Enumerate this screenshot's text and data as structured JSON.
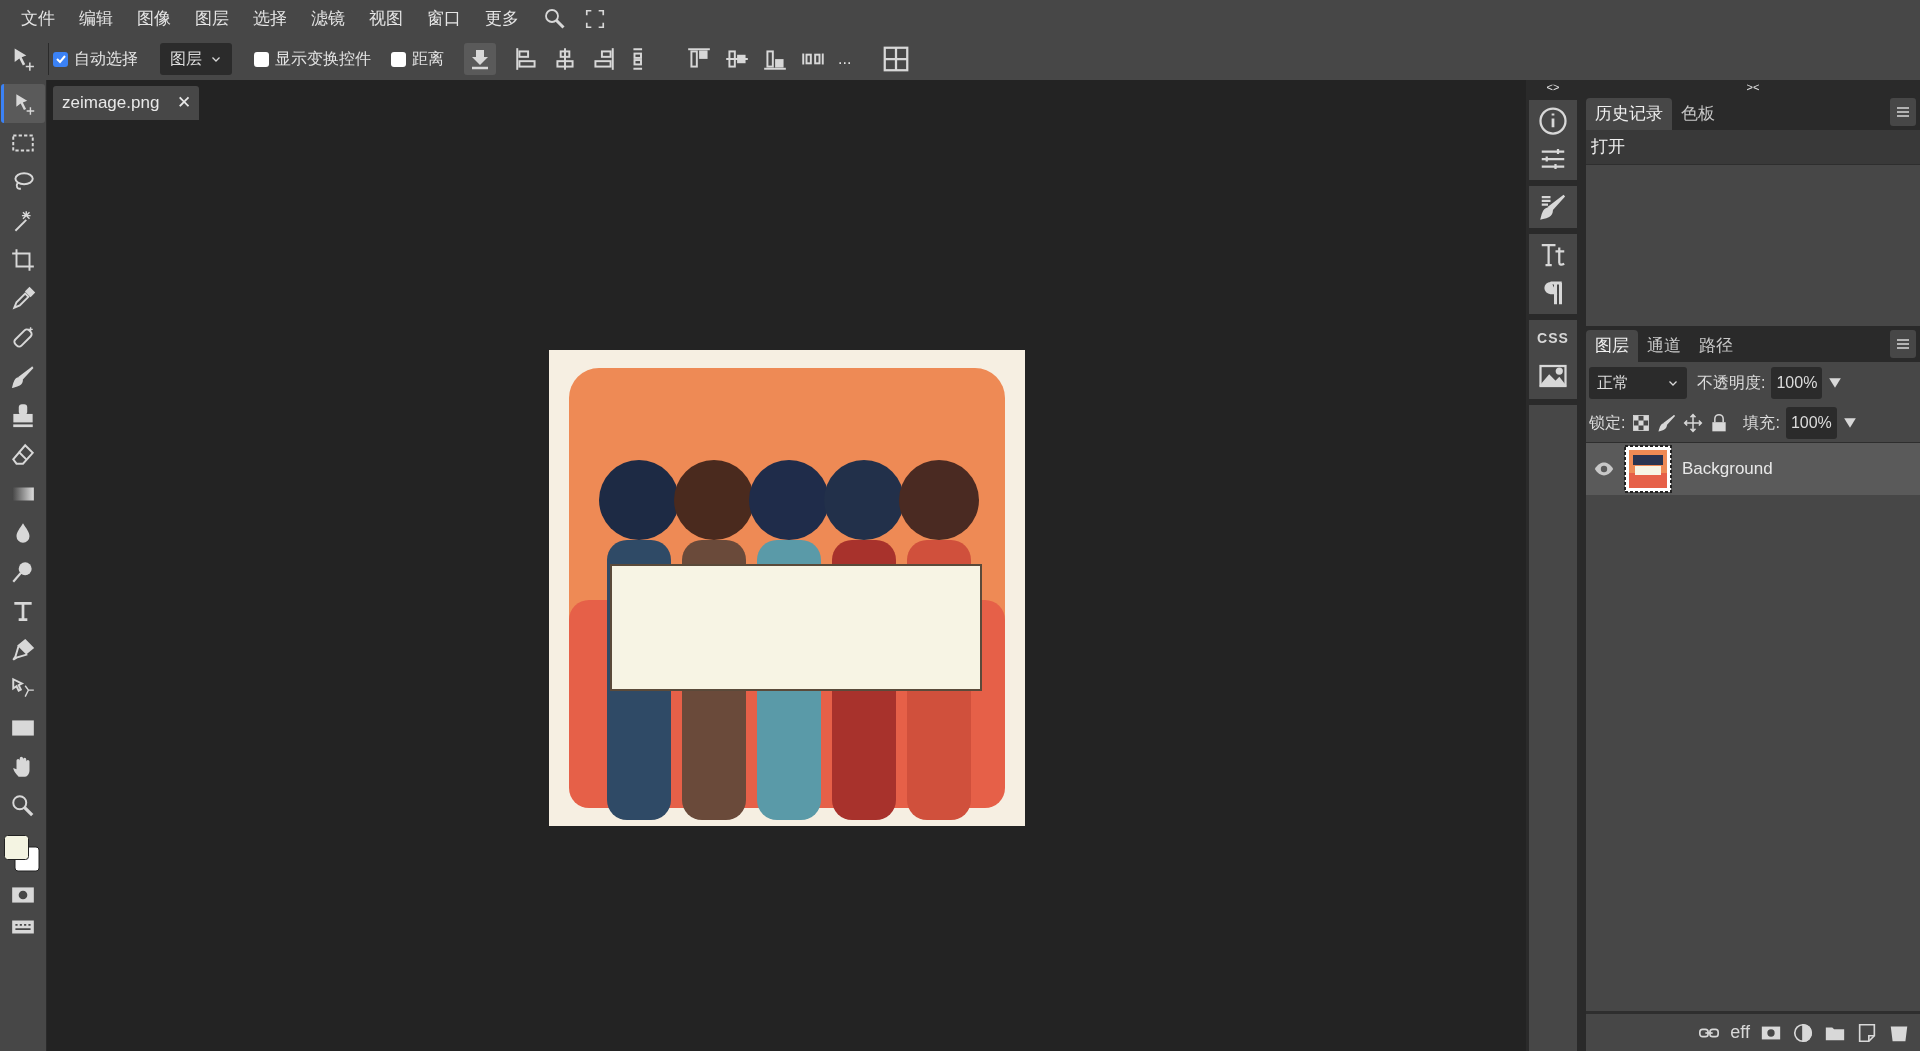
{
  "menu": [
    "文件",
    "编辑",
    "图像",
    "图层",
    "选择",
    "滤镜",
    "视图",
    "窗口",
    "更多"
  ],
  "options_bar": {
    "auto_select": {
      "label": "自动选择",
      "checked": true
    },
    "target": "图层",
    "show_transform": {
      "label": "显示变换控件",
      "checked": false
    },
    "distance": {
      "label": "距离",
      "checked": false
    },
    "more": "..."
  },
  "tools": [
    {
      "kind": "move",
      "selected": true
    },
    {
      "kind": "marquee",
      "selected": false
    },
    {
      "kind": "lasso",
      "selected": false
    },
    {
      "kind": "wand",
      "selected": false
    },
    {
      "kind": "crop",
      "selected": false
    },
    {
      "kind": "eyedropper",
      "selected": false
    },
    {
      "kind": "healing",
      "selected": false
    },
    {
      "kind": "brush",
      "selected": false
    },
    {
      "kind": "stamp",
      "selected": false
    },
    {
      "kind": "eraser",
      "selected": false
    },
    {
      "kind": "gradient",
      "selected": false
    },
    {
      "kind": "blur",
      "selected": false
    },
    {
      "kind": "dodge",
      "selected": false
    },
    {
      "kind": "type",
      "selected": false
    },
    {
      "kind": "pen",
      "selected": false
    },
    {
      "kind": "path",
      "selected": false
    },
    {
      "kind": "rect",
      "selected": false
    },
    {
      "kind": "hand",
      "selected": false
    },
    {
      "kind": "zoom",
      "selected": false
    }
  ],
  "color_swatches": [
    {
      "color": "#f4f4e2"
    },
    {
      "color": "#ffffff"
    }
  ],
  "document_tab": {
    "title": "zeimage.png",
    "close": "✕"
  },
  "side_strip": {
    "expand": "<>",
    "css": "CSS"
  },
  "collapse": "><",
  "history_panel": {
    "tabs": [
      {
        "label": "历史记录",
        "selected": true
      },
      {
        "label": "色板",
        "selected": false
      }
    ],
    "entries": [
      {
        "label": "打开",
        "selected": true
      }
    ]
  },
  "layers_panel": {
    "tabs": [
      {
        "label": "图层",
        "selected": true
      },
      {
        "label": "通道",
        "selected": false
      },
      {
        "label": "路径",
        "selected": false
      }
    ],
    "blend_mode": "正常",
    "opacity_label": "不透明度:",
    "opacity": "100%",
    "lock_label": "锁定:",
    "fill_label": "填充:",
    "fill": "100%",
    "layers": [
      {
        "name": "Background",
        "visible": true,
        "selected": true
      }
    ],
    "footer": {
      "effects": "eff"
    }
  }
}
